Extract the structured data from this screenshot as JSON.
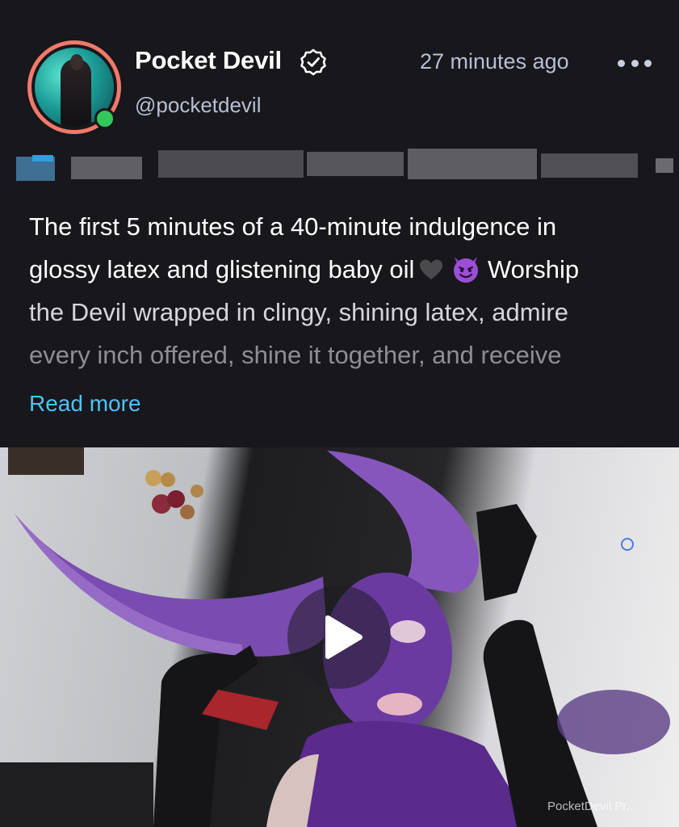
{
  "post": {
    "author": {
      "display_name": "Pocket Devil",
      "handle": "@pocketdevil",
      "verified": true,
      "online": true
    },
    "timestamp": "27 minutes ago",
    "lines": [
      "The first 5 minutes of a 40-minute indulgence in",
      "glossy latex and glistening baby oil",
      "Worship",
      "the Devil wrapped in clingy, shining latex, admire",
      "every inch offered, shine it together, and receive"
    ],
    "emojis": [
      "black-heart-emoji",
      "smiling-devil-emoji"
    ],
    "read_more": "Read more"
  },
  "media": {
    "type": "video",
    "watermark": "PocketDevil Pr..."
  },
  "colors": {
    "background": "#17171c",
    "link": "#4fc3f7",
    "avatar_ring": "#f3796a",
    "online": "#34c759",
    "secondary_text": "#b8bfd3"
  }
}
